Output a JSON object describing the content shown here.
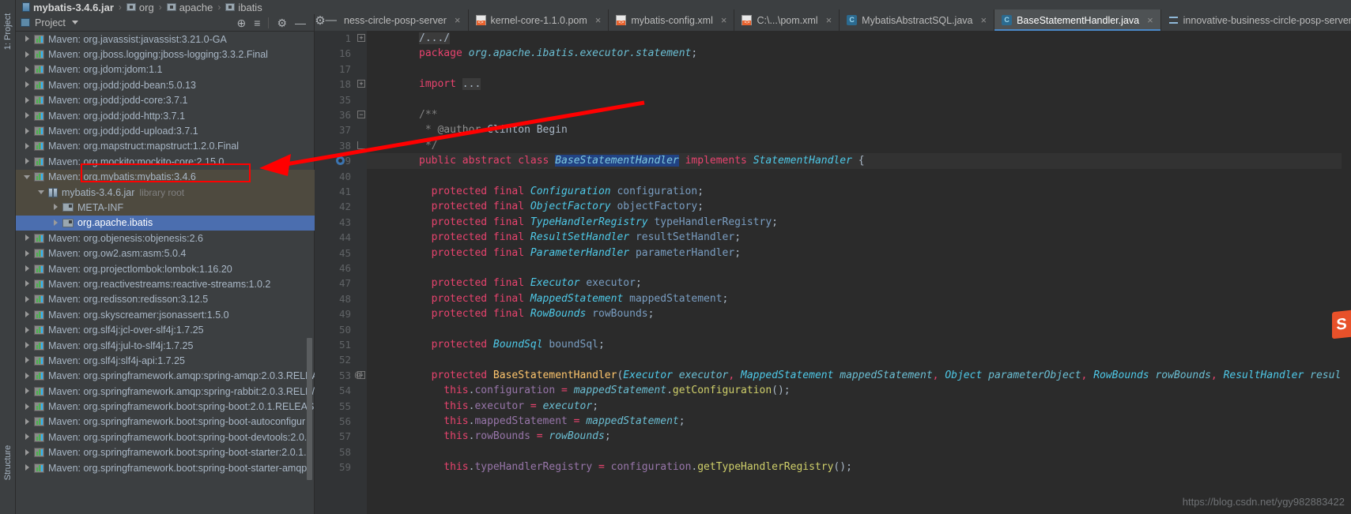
{
  "breadcrumb": {
    "items": [
      {
        "label": "mybatis-3.4.6.jar",
        "icon": "jar-icon"
      },
      {
        "label": "org",
        "icon": "package-icon"
      },
      {
        "label": "apache",
        "icon": "package-icon"
      },
      {
        "label": "ibatis",
        "icon": "package-icon"
      }
    ],
    "separator": "›"
  },
  "tool_windows": {
    "left_label": "1: Project",
    "bottom_label": "Structure"
  },
  "project_panel": {
    "title": "Project",
    "dropdown_caret": "▾",
    "tools": [
      {
        "name": "locate-icon",
        "glyph": "⊕"
      },
      {
        "name": "collapse-all-icon",
        "glyph": "≡"
      },
      {
        "name": "settings-gear-icon",
        "glyph": "⚙"
      },
      {
        "name": "hide-icon",
        "glyph": "—"
      }
    ]
  },
  "tree": {
    "items": [
      {
        "label": "Maven: org.javassist:javassist:3.21.0-GA",
        "indent": 1,
        "arrow": "closed",
        "icon": "library-icon",
        "state": "normal"
      },
      {
        "label": "Maven: org.jboss.logging:jboss-logging:3.3.2.Final",
        "indent": 1,
        "arrow": "closed",
        "icon": "library-icon",
        "state": "normal"
      },
      {
        "label": "Maven: org.jdom:jdom:1.1",
        "indent": 1,
        "arrow": "closed",
        "icon": "library-icon",
        "state": "normal"
      },
      {
        "label": "Maven: org.jodd:jodd-bean:5.0.13",
        "indent": 1,
        "arrow": "closed",
        "icon": "library-icon",
        "state": "normal"
      },
      {
        "label": "Maven: org.jodd:jodd-core:3.7.1",
        "indent": 1,
        "arrow": "closed",
        "icon": "library-icon",
        "state": "normal"
      },
      {
        "label": "Maven: org.jodd:jodd-http:3.7.1",
        "indent": 1,
        "arrow": "closed",
        "icon": "library-icon",
        "state": "normal"
      },
      {
        "label": "Maven: org.jodd:jodd-upload:3.7.1",
        "indent": 1,
        "arrow": "closed",
        "icon": "library-icon",
        "state": "normal"
      },
      {
        "label": "Maven: org.mapstruct:mapstruct:1.2.0.Final",
        "indent": 1,
        "arrow": "closed",
        "icon": "library-icon",
        "state": "normal"
      },
      {
        "label": "Maven: org.mockito:mockito-core:2.15.0",
        "indent": 1,
        "arrow": "closed",
        "icon": "library-icon",
        "state": "normal"
      },
      {
        "label": "Maven: org.mybatis:mybatis:3.4.6",
        "indent": 1,
        "arrow": "open",
        "icon": "library-icon",
        "state": "highlighted"
      },
      {
        "label": "mybatis-3.4.6.jar",
        "sublabel": "library root",
        "indent": 2,
        "arrow": "open",
        "icon": "jar-file-icon",
        "state": "parent-selected"
      },
      {
        "label": "META-INF",
        "indent": 3,
        "arrow": "closed",
        "icon": "package-folder-icon",
        "state": "parent-selected"
      },
      {
        "label": "org.apache.ibatis",
        "indent": 3,
        "arrow": "closed",
        "icon": "package-folder-icon",
        "state": "selected"
      },
      {
        "label": "Maven: org.objenesis:objenesis:2.6",
        "indent": 1,
        "arrow": "closed",
        "icon": "library-icon",
        "state": "normal"
      },
      {
        "label": "Maven: org.ow2.asm:asm:5.0.4",
        "indent": 1,
        "arrow": "closed",
        "icon": "library-icon",
        "state": "normal"
      },
      {
        "label": "Maven: org.projectlombok:lombok:1.16.20",
        "indent": 1,
        "arrow": "closed",
        "icon": "library-icon",
        "state": "normal"
      },
      {
        "label": "Maven: org.reactivestreams:reactive-streams:1.0.2",
        "indent": 1,
        "arrow": "closed",
        "icon": "library-icon",
        "state": "normal"
      },
      {
        "label": "Maven: org.redisson:redisson:3.12.5",
        "indent": 1,
        "arrow": "closed",
        "icon": "library-icon",
        "state": "normal"
      },
      {
        "label": "Maven: org.skyscreamer:jsonassert:1.5.0",
        "indent": 1,
        "arrow": "closed",
        "icon": "library-icon",
        "state": "normal"
      },
      {
        "label": "Maven: org.slf4j:jcl-over-slf4j:1.7.25",
        "indent": 1,
        "arrow": "closed",
        "icon": "library-icon",
        "state": "normal"
      },
      {
        "label": "Maven: org.slf4j:jul-to-slf4j:1.7.25",
        "indent": 1,
        "arrow": "closed",
        "icon": "library-icon",
        "state": "normal"
      },
      {
        "label": "Maven: org.slf4j:slf4j-api:1.7.25",
        "indent": 1,
        "arrow": "closed",
        "icon": "library-icon",
        "state": "normal"
      },
      {
        "label": "Maven: org.springframework.amqp:spring-amqp:2.0.3.RELEA",
        "indent": 1,
        "arrow": "closed",
        "icon": "library-icon",
        "state": "normal"
      },
      {
        "label": "Maven: org.springframework.amqp:spring-rabbit:2.0.3.RELE/",
        "indent": 1,
        "arrow": "closed",
        "icon": "library-icon",
        "state": "normal"
      },
      {
        "label": "Maven: org.springframework.boot:spring-boot:2.0.1.RELEAS",
        "indent": 1,
        "arrow": "closed",
        "icon": "library-icon",
        "state": "normal"
      },
      {
        "label": "Maven: org.springframework.boot:spring-boot-autoconfigur",
        "indent": 1,
        "arrow": "closed",
        "icon": "library-icon",
        "state": "normal"
      },
      {
        "label": "Maven: org.springframework.boot:spring-boot-devtools:2.0.",
        "indent": 1,
        "arrow": "closed",
        "icon": "library-icon",
        "state": "normal"
      },
      {
        "label": "Maven: org.springframework.boot:spring-boot-starter:2.0.1.",
        "indent": 1,
        "arrow": "closed",
        "icon": "library-icon",
        "state": "normal"
      },
      {
        "label": "Maven: org.springframework.boot:spring-boot-starter-amqp",
        "indent": 1,
        "arrow": "closed",
        "icon": "library-icon",
        "state": "normal"
      }
    ]
  },
  "editor_tabs": {
    "items": [
      {
        "label": "ness-circle-posp-server",
        "icon": "module-icon",
        "active": false,
        "closable": true
      },
      {
        "label": "kernel-core-1.1.0.pom",
        "icon": "xml-icon",
        "active": false,
        "closable": true
      },
      {
        "label": "mybatis-config.xml",
        "icon": "xml-icon",
        "active": false,
        "closable": true
      },
      {
        "label": "C:\\...\\pom.xml",
        "icon": "xml-icon",
        "active": false,
        "closable": true
      },
      {
        "label": "MybatisAbstractSQL.java",
        "icon": "java-icon",
        "active": false,
        "closable": true
      },
      {
        "label": "BaseStatementHandler.java",
        "icon": "java-icon",
        "active": true,
        "closable": true
      },
      {
        "label": "innovative-business-circle-posp-server",
        "icon": "module-icon",
        "active": false,
        "closable": false
      }
    ]
  },
  "code": {
    "lines": [
      {
        "num": "1",
        "fold": "plus",
        "segments": [
          {
            "t": "/.../",
            "c": "foldbg"
          }
        ]
      },
      {
        "num": "16",
        "fold": "",
        "segments": [
          {
            "t": "package ",
            "c": "kw"
          },
          {
            "t": "org.apache.ibatis.executor.statement",
            "c": "cls2"
          },
          {
            "t": ";",
            "c": "pn"
          }
        ]
      },
      {
        "num": "17",
        "fold": "",
        "segments": []
      },
      {
        "num": "18",
        "fold": "plus",
        "segments": [
          {
            "t": "import ",
            "c": "kw"
          },
          {
            "t": "...",
            "c": "foldbg"
          }
        ]
      },
      {
        "num": "35",
        "fold": "",
        "segments": []
      },
      {
        "num": "36",
        "fold": "open",
        "segments": [
          {
            "t": "/**",
            "c": "cmt"
          }
        ]
      },
      {
        "num": "37",
        "fold": "",
        "segments": [
          {
            "t": " * ",
            "c": "cmt"
          },
          {
            "t": "@author ",
            "c": "an"
          },
          {
            "t": "Clinton Begin",
            "c": "pn"
          }
        ]
      },
      {
        "num": "38",
        "fold": "close",
        "segments": [
          {
            "t": " */",
            "c": "cmt"
          }
        ]
      },
      {
        "num": "39",
        "fold": "",
        "current": true,
        "gutter_icon": "override-icon",
        "segments": [
          {
            "t": "public ",
            "c": "kw"
          },
          {
            "t": "abstract ",
            "c": "kw"
          },
          {
            "t": "class ",
            "c": "kw"
          },
          {
            "t": "BaseStatementHandler",
            "c": "selbg"
          },
          {
            "t": " implements ",
            "c": "kw"
          },
          {
            "t": "StatementHandler",
            "c": "cls"
          },
          {
            "t": " {",
            "c": "pn"
          }
        ]
      },
      {
        "num": "40",
        "fold": "",
        "segments": []
      },
      {
        "num": "41",
        "fold": "",
        "segments": [
          {
            "t": "  protected ",
            "c": "kw"
          },
          {
            "t": "final ",
            "c": "kw"
          },
          {
            "t": "Configuration ",
            "c": "cls"
          },
          {
            "t": "configuration",
            "c": "fld"
          },
          {
            "t": ";",
            "c": "pn"
          }
        ]
      },
      {
        "num": "42",
        "fold": "",
        "segments": [
          {
            "t": "  protected ",
            "c": "kw"
          },
          {
            "t": "final ",
            "c": "kw"
          },
          {
            "t": "ObjectFactory ",
            "c": "cls"
          },
          {
            "t": "objectFactory",
            "c": "fld"
          },
          {
            "t": ";",
            "c": "pn"
          }
        ]
      },
      {
        "num": "43",
        "fold": "",
        "segments": [
          {
            "t": "  protected ",
            "c": "kw"
          },
          {
            "t": "final ",
            "c": "kw"
          },
          {
            "t": "TypeHandlerRegistry ",
            "c": "cls"
          },
          {
            "t": "typeHandlerRegistry",
            "c": "fld"
          },
          {
            "t": ";",
            "c": "pn"
          }
        ]
      },
      {
        "num": "44",
        "fold": "",
        "segments": [
          {
            "t": "  protected ",
            "c": "kw"
          },
          {
            "t": "final ",
            "c": "kw"
          },
          {
            "t": "ResultSetHandler ",
            "c": "cls"
          },
          {
            "t": "resultSetHandler",
            "c": "fld"
          },
          {
            "t": ";",
            "c": "pn"
          }
        ]
      },
      {
        "num": "45",
        "fold": "",
        "segments": [
          {
            "t": "  protected ",
            "c": "kw"
          },
          {
            "t": "final ",
            "c": "kw"
          },
          {
            "t": "ParameterHandler ",
            "c": "cls"
          },
          {
            "t": "parameterHandler",
            "c": "fld"
          },
          {
            "t": ";",
            "c": "pn"
          }
        ]
      },
      {
        "num": "46",
        "fold": "",
        "segments": []
      },
      {
        "num": "47",
        "fold": "",
        "segments": [
          {
            "t": "  protected ",
            "c": "kw"
          },
          {
            "t": "final ",
            "c": "kw"
          },
          {
            "t": "Executor ",
            "c": "cls"
          },
          {
            "t": "executor",
            "c": "fld"
          },
          {
            "t": ";",
            "c": "pn"
          }
        ]
      },
      {
        "num": "48",
        "fold": "",
        "segments": [
          {
            "t": "  protected ",
            "c": "kw"
          },
          {
            "t": "final ",
            "c": "kw"
          },
          {
            "t": "MappedStatement ",
            "c": "cls"
          },
          {
            "t": "mappedStatement",
            "c": "fld"
          },
          {
            "t": ";",
            "c": "pn"
          }
        ]
      },
      {
        "num": "49",
        "fold": "",
        "segments": [
          {
            "t": "  protected ",
            "c": "kw"
          },
          {
            "t": "final ",
            "c": "kw"
          },
          {
            "t": "RowBounds ",
            "c": "cls"
          },
          {
            "t": "rowBounds",
            "c": "fld"
          },
          {
            "t": ";",
            "c": "pn"
          }
        ]
      },
      {
        "num": "50",
        "fold": "",
        "segments": []
      },
      {
        "num": "51",
        "fold": "",
        "segments": [
          {
            "t": "  protected ",
            "c": "kw"
          },
          {
            "t": "BoundSql ",
            "c": "cls"
          },
          {
            "t": "boundSql",
            "c": "fld"
          },
          {
            "t": ";",
            "c": "pn"
          }
        ]
      },
      {
        "num": "52",
        "fold": "",
        "segments": []
      },
      {
        "num": "53",
        "fold": "open",
        "gutter_at": "@",
        "segments": [
          {
            "t": "  protected ",
            "c": "kw"
          },
          {
            "t": "BaseStatementHandler",
            "c": "mth"
          },
          {
            "t": "(",
            "c": "pn"
          },
          {
            "t": "Executor ",
            "c": "cls"
          },
          {
            "t": "executor",
            "c": "cls2"
          },
          {
            "t": ", ",
            "c": "op"
          },
          {
            "t": "MappedStatement ",
            "c": "cls"
          },
          {
            "t": "mappedStatement",
            "c": "cls2"
          },
          {
            "t": ", ",
            "c": "op"
          },
          {
            "t": "Object ",
            "c": "cls"
          },
          {
            "t": "parameterObject",
            "c": "cls2"
          },
          {
            "t": ", ",
            "c": "op"
          },
          {
            "t": "RowBounds ",
            "c": "cls"
          },
          {
            "t": "rowBounds",
            "c": "cls2"
          },
          {
            "t": ", ",
            "c": "op"
          },
          {
            "t": "ResultHandler ",
            "c": "cls"
          },
          {
            "t": "resultHa",
            "c": "cls2"
          }
        ]
      },
      {
        "num": "54",
        "fold": "",
        "segments": [
          {
            "t": "    this",
            "c": "kw"
          },
          {
            "t": ".",
            "c": "pn"
          },
          {
            "t": "configuration",
            "c": "var"
          },
          {
            "t": " = ",
            "c": "op"
          },
          {
            "t": "mappedStatement",
            "c": "cls2"
          },
          {
            "t": ".",
            "c": "pn"
          },
          {
            "t": "getConfiguration",
            "c": "yel"
          },
          {
            "t": "();",
            "c": "pn"
          }
        ]
      },
      {
        "num": "55",
        "fold": "",
        "segments": [
          {
            "t": "    this",
            "c": "kw"
          },
          {
            "t": ".",
            "c": "pn"
          },
          {
            "t": "executor",
            "c": "var"
          },
          {
            "t": " = ",
            "c": "op"
          },
          {
            "t": "executor",
            "c": "cls2"
          },
          {
            "t": ";",
            "c": "pn"
          }
        ]
      },
      {
        "num": "56",
        "fold": "",
        "segments": [
          {
            "t": "    this",
            "c": "kw"
          },
          {
            "t": ".",
            "c": "pn"
          },
          {
            "t": "mappedStatement",
            "c": "var"
          },
          {
            "t": " = ",
            "c": "op"
          },
          {
            "t": "mappedStatement",
            "c": "cls2"
          },
          {
            "t": ";",
            "c": "pn"
          }
        ]
      },
      {
        "num": "57",
        "fold": "",
        "segments": [
          {
            "t": "    this",
            "c": "kw"
          },
          {
            "t": ".",
            "c": "pn"
          },
          {
            "t": "rowBounds",
            "c": "var"
          },
          {
            "t": " = ",
            "c": "op"
          },
          {
            "t": "rowBounds",
            "c": "cls2"
          },
          {
            "t": ";",
            "c": "pn"
          }
        ]
      },
      {
        "num": "58",
        "fold": "",
        "segments": []
      },
      {
        "num": "59",
        "fold": "",
        "segments": [
          {
            "t": "    this",
            "c": "kw"
          },
          {
            "t": ".",
            "c": "pn"
          },
          {
            "t": "typeHandlerRegistry",
            "c": "var"
          },
          {
            "t": " = ",
            "c": "op"
          },
          {
            "t": "configuration",
            "c": "var"
          },
          {
            "t": ".",
            "c": "pn"
          },
          {
            "t": "getTypeHandlerRegistry",
            "c": "yel"
          },
          {
            "t": "();",
            "c": "pn"
          }
        ]
      }
    ]
  },
  "annotations": {
    "red_arrow": {
      "name": "red-arrow-annotation",
      "color": "#ff0000"
    },
    "red_box": {
      "name": "red-highlight-box",
      "color": "#ff0000",
      "target": "Maven: org.mybatis:mybatis:3.4.6"
    }
  },
  "watermark": {
    "url": "https://blog.csdn.net/ygy982883422",
    "logo_letter": "S"
  },
  "colors": {
    "panel_bg": "#3c3f41",
    "editor_bg": "#2b2b2b",
    "selection_blue": "#4b6eaf",
    "accent_tab": "#4a88c7",
    "annotation_red": "#ff0000",
    "keyword": "#e8436e",
    "class_name": "#4ec9e8",
    "method": "#ffc66d"
  }
}
